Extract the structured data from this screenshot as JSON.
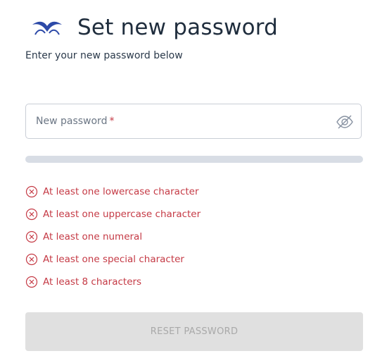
{
  "header": {
    "logo_icon": "bird-logo-icon",
    "title": "Set new password",
    "subtitle": "Enter your new password below"
  },
  "password_field": {
    "label": "New password",
    "required_mark": "*",
    "value": "",
    "visibility_icon": "eye-off-icon"
  },
  "strength": {
    "fraction": 0,
    "track_color": "#d8dde5"
  },
  "requirements": [
    {
      "label": "At least one lowercase character",
      "status": "unmet",
      "icon": "x-circle-icon"
    },
    {
      "label": "At least one uppercase character",
      "status": "unmet",
      "icon": "x-circle-icon"
    },
    {
      "label": "At least one numeral",
      "status": "unmet",
      "icon": "x-circle-icon"
    },
    {
      "label": "At least one special character",
      "status": "unmet",
      "icon": "x-circle-icon"
    },
    {
      "label": "At least 8 characters",
      "status": "unmet",
      "icon": "x-circle-icon"
    }
  ],
  "submit": {
    "label": "RESET PASSWORD",
    "disabled": true
  },
  "colors": {
    "brand": "#2d4aa8",
    "error": "#c53a45",
    "disabled_bg": "#e0e0e0",
    "disabled_text": "#a9a9a9"
  }
}
